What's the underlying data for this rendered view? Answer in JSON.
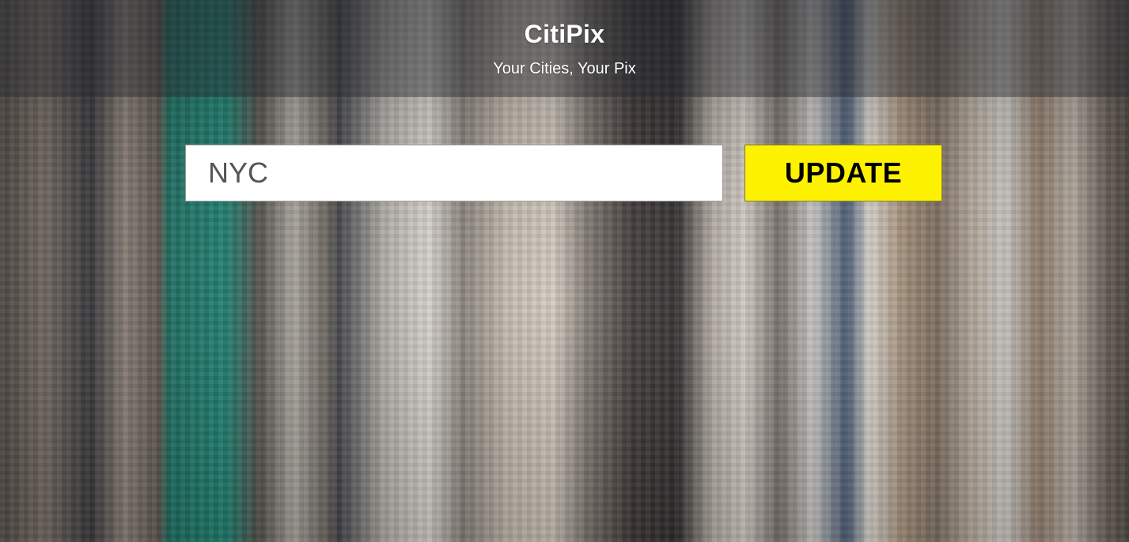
{
  "app": {
    "title": "CitiPix",
    "subtitle": "Your Cities, Your Pix"
  },
  "form": {
    "city_value": "NYC",
    "city_placeholder": "",
    "update_label": "UPDATE"
  },
  "colors": {
    "accent_button": "#fff200",
    "header_overlay": "rgba(40,44,50,0.42)"
  }
}
